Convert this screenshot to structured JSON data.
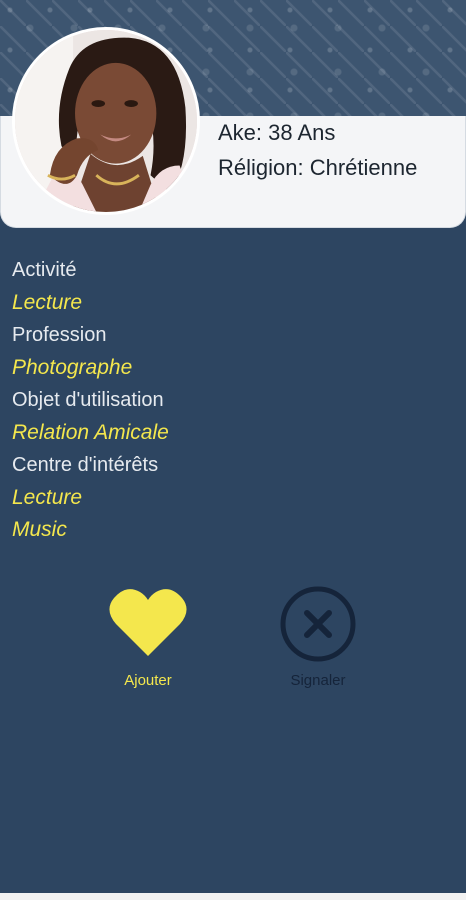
{
  "profile": {
    "age_line": "Ake: 38 Ans",
    "religion_line": "Réligion: Chrétienne"
  },
  "details": [
    {
      "kind": "label",
      "text": "Activité"
    },
    {
      "kind": "value",
      "text": "Lecture"
    },
    {
      "kind": "label",
      "text": "Profession"
    },
    {
      "kind": "value",
      "text": "Photographe"
    },
    {
      "kind": "label",
      "text": "Objet d'utilisation"
    },
    {
      "kind": "value",
      "text": "Relation Amicale"
    },
    {
      "kind": "label",
      "text": "Centre d'intérêts"
    },
    {
      "kind": "value",
      "text": "Lecture"
    },
    {
      "kind": "value",
      "text": "Music"
    }
  ],
  "actions": {
    "add_label": "Ajouter",
    "add_icon": "heart-icon",
    "report_label": "Signaler",
    "report_icon": "close-circle-icon"
  },
  "colors": {
    "background": "#2d4561",
    "accent": "#f4e74d",
    "card": "#f4f5f7",
    "report": "#15243a"
  }
}
